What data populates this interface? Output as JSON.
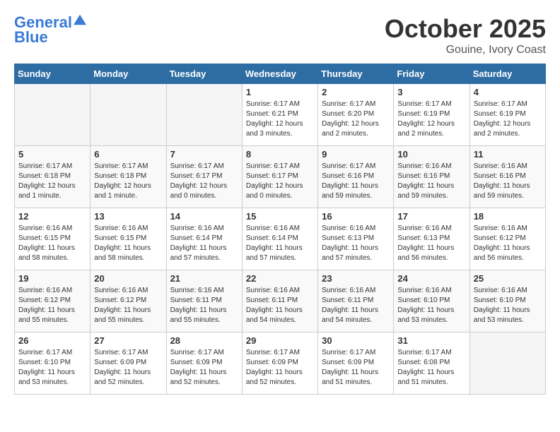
{
  "header": {
    "logo_line1": "General",
    "logo_line2": "Blue",
    "month": "October 2025",
    "location": "Gouine, Ivory Coast"
  },
  "weekdays": [
    "Sunday",
    "Monday",
    "Tuesday",
    "Wednesday",
    "Thursday",
    "Friday",
    "Saturday"
  ],
  "weeks": [
    [
      {
        "day": "",
        "info": ""
      },
      {
        "day": "",
        "info": ""
      },
      {
        "day": "",
        "info": ""
      },
      {
        "day": "1",
        "info": "Sunrise: 6:17 AM\nSunset: 6:21 PM\nDaylight: 12 hours\nand 3 minutes."
      },
      {
        "day": "2",
        "info": "Sunrise: 6:17 AM\nSunset: 6:20 PM\nDaylight: 12 hours\nand 2 minutes."
      },
      {
        "day": "3",
        "info": "Sunrise: 6:17 AM\nSunset: 6:19 PM\nDaylight: 12 hours\nand 2 minutes."
      },
      {
        "day": "4",
        "info": "Sunrise: 6:17 AM\nSunset: 6:19 PM\nDaylight: 12 hours\nand 2 minutes."
      }
    ],
    [
      {
        "day": "5",
        "info": "Sunrise: 6:17 AM\nSunset: 6:18 PM\nDaylight: 12 hours\nand 1 minute."
      },
      {
        "day": "6",
        "info": "Sunrise: 6:17 AM\nSunset: 6:18 PM\nDaylight: 12 hours\nand 1 minute."
      },
      {
        "day": "7",
        "info": "Sunrise: 6:17 AM\nSunset: 6:17 PM\nDaylight: 12 hours\nand 0 minutes."
      },
      {
        "day": "8",
        "info": "Sunrise: 6:17 AM\nSunset: 6:17 PM\nDaylight: 12 hours\nand 0 minutes."
      },
      {
        "day": "9",
        "info": "Sunrise: 6:17 AM\nSunset: 6:16 PM\nDaylight: 11 hours\nand 59 minutes."
      },
      {
        "day": "10",
        "info": "Sunrise: 6:16 AM\nSunset: 6:16 PM\nDaylight: 11 hours\nand 59 minutes."
      },
      {
        "day": "11",
        "info": "Sunrise: 6:16 AM\nSunset: 6:16 PM\nDaylight: 11 hours\nand 59 minutes."
      }
    ],
    [
      {
        "day": "12",
        "info": "Sunrise: 6:16 AM\nSunset: 6:15 PM\nDaylight: 11 hours\nand 58 minutes."
      },
      {
        "day": "13",
        "info": "Sunrise: 6:16 AM\nSunset: 6:15 PM\nDaylight: 11 hours\nand 58 minutes."
      },
      {
        "day": "14",
        "info": "Sunrise: 6:16 AM\nSunset: 6:14 PM\nDaylight: 11 hours\nand 57 minutes."
      },
      {
        "day": "15",
        "info": "Sunrise: 6:16 AM\nSunset: 6:14 PM\nDaylight: 11 hours\nand 57 minutes."
      },
      {
        "day": "16",
        "info": "Sunrise: 6:16 AM\nSunset: 6:13 PM\nDaylight: 11 hours\nand 57 minutes."
      },
      {
        "day": "17",
        "info": "Sunrise: 6:16 AM\nSunset: 6:13 PM\nDaylight: 11 hours\nand 56 minutes."
      },
      {
        "day": "18",
        "info": "Sunrise: 6:16 AM\nSunset: 6:12 PM\nDaylight: 11 hours\nand 56 minutes."
      }
    ],
    [
      {
        "day": "19",
        "info": "Sunrise: 6:16 AM\nSunset: 6:12 PM\nDaylight: 11 hours\nand 55 minutes."
      },
      {
        "day": "20",
        "info": "Sunrise: 6:16 AM\nSunset: 6:12 PM\nDaylight: 11 hours\nand 55 minutes."
      },
      {
        "day": "21",
        "info": "Sunrise: 6:16 AM\nSunset: 6:11 PM\nDaylight: 11 hours\nand 55 minutes."
      },
      {
        "day": "22",
        "info": "Sunrise: 6:16 AM\nSunset: 6:11 PM\nDaylight: 11 hours\nand 54 minutes."
      },
      {
        "day": "23",
        "info": "Sunrise: 6:16 AM\nSunset: 6:11 PM\nDaylight: 11 hours\nand 54 minutes."
      },
      {
        "day": "24",
        "info": "Sunrise: 6:16 AM\nSunset: 6:10 PM\nDaylight: 11 hours\nand 53 minutes."
      },
      {
        "day": "25",
        "info": "Sunrise: 6:16 AM\nSunset: 6:10 PM\nDaylight: 11 hours\nand 53 minutes."
      }
    ],
    [
      {
        "day": "26",
        "info": "Sunrise: 6:17 AM\nSunset: 6:10 PM\nDaylight: 11 hours\nand 53 minutes."
      },
      {
        "day": "27",
        "info": "Sunrise: 6:17 AM\nSunset: 6:09 PM\nDaylight: 11 hours\nand 52 minutes."
      },
      {
        "day": "28",
        "info": "Sunrise: 6:17 AM\nSunset: 6:09 PM\nDaylight: 11 hours\nand 52 minutes."
      },
      {
        "day": "29",
        "info": "Sunrise: 6:17 AM\nSunset: 6:09 PM\nDaylight: 11 hours\nand 52 minutes."
      },
      {
        "day": "30",
        "info": "Sunrise: 6:17 AM\nSunset: 6:09 PM\nDaylight: 11 hours\nand 51 minutes."
      },
      {
        "day": "31",
        "info": "Sunrise: 6:17 AM\nSunset: 6:08 PM\nDaylight: 11 hours\nand 51 minutes."
      },
      {
        "day": "",
        "info": ""
      }
    ]
  ]
}
